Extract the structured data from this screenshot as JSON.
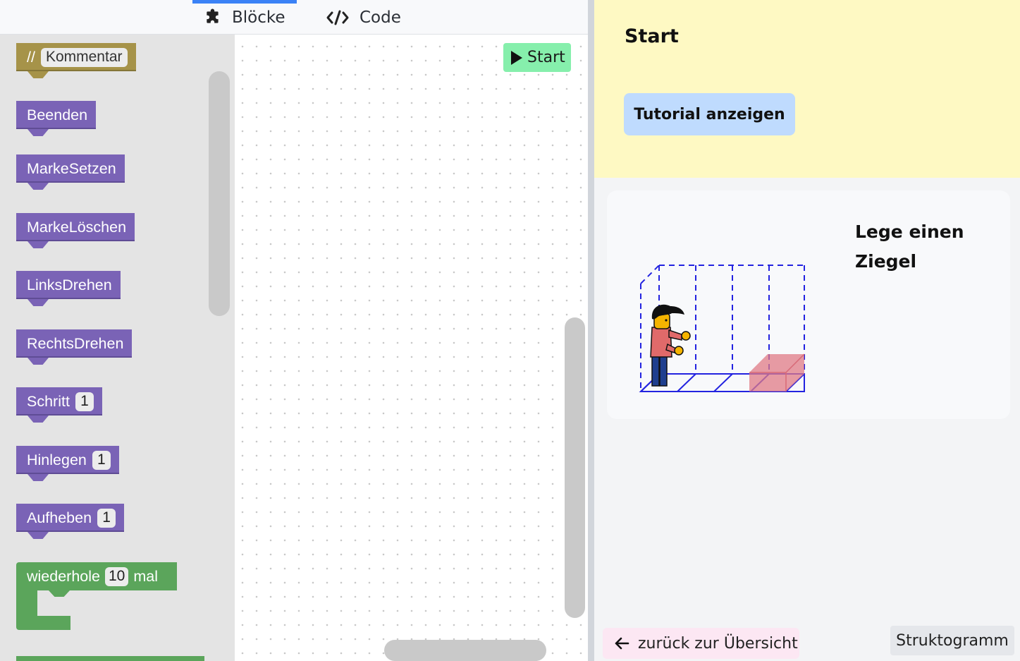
{
  "tabs": {
    "blocks_label": "Blöcke",
    "code_label": "Code"
  },
  "toolbox": {
    "comment": {
      "prefix": "//",
      "field": "Kommentar"
    },
    "blocks": [
      {
        "label": "Beenden"
      },
      {
        "label": "MarkeSetzen"
      },
      {
        "label": "MarkeLöschen"
      },
      {
        "label": "LinksDrehen"
      },
      {
        "label": "RechtsDrehen"
      },
      {
        "label": "Schritt",
        "value": "1"
      },
      {
        "label": "Hinlegen",
        "value": "1"
      },
      {
        "label": "Aufheben",
        "value": "1"
      }
    ],
    "loop": {
      "label_before": "wiederhole",
      "value": "10",
      "label_after": "mal"
    }
  },
  "workspace": {
    "start_label": "Start"
  },
  "task": {
    "title": "Start",
    "tutorial_label": "Tutorial anzeigen",
    "description": "Lege einen Ziegel"
  },
  "footer": {
    "back_label": "zurück zur Übersicht",
    "struktogramm_label": "Struktogramm"
  },
  "colors": {
    "accent": "#3b82f6",
    "block_purple": "#7a63b6",
    "block_olive": "#a69349",
    "block_green": "#5ba55b",
    "start_green": "#86efac",
    "header_yellow": "#fef9c3",
    "tutorial_blue": "#bfdbfe",
    "back_pink": "#fce7f3"
  }
}
